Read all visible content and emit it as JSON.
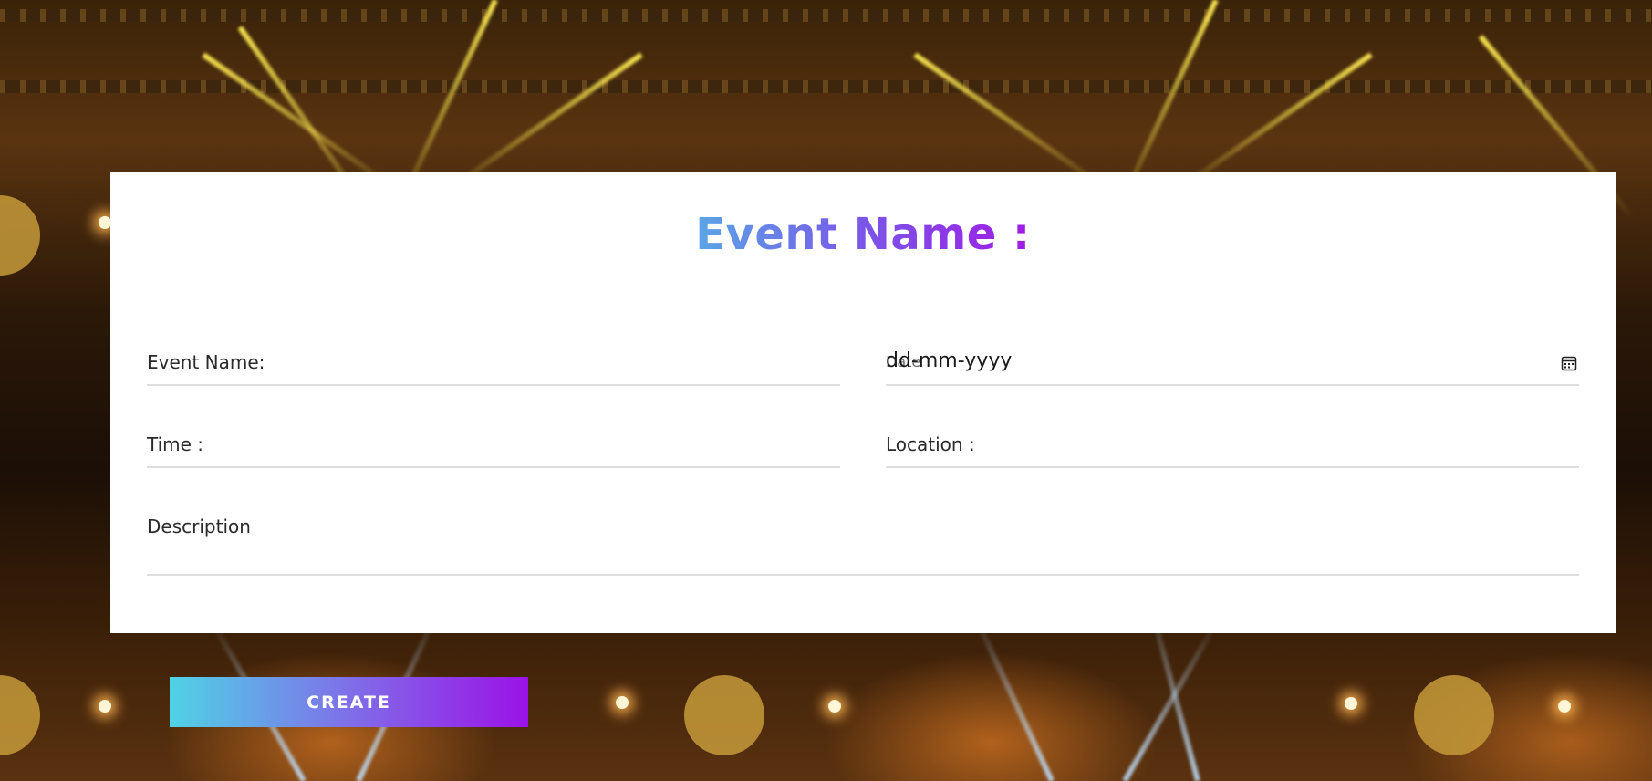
{
  "form": {
    "title": "Event Name :",
    "event_name_label": "Event Name:",
    "date_label": "Date",
    "date_placeholder": "dd-mm-yyyy",
    "time_label": "Time :",
    "location_label": "Location :",
    "description_label": "Description"
  },
  "actions": {
    "create_label": "CREATE"
  },
  "colors": {
    "title_gradient": [
      "#5aa6e6",
      "#7a56e8",
      "#a01be6"
    ],
    "button_gradient": [
      "#4fd3e6",
      "#7f6fe8",
      "#9b12e8"
    ],
    "card_background": "#ffffff"
  },
  "icons": {
    "date_picker": "calendar-icon"
  }
}
